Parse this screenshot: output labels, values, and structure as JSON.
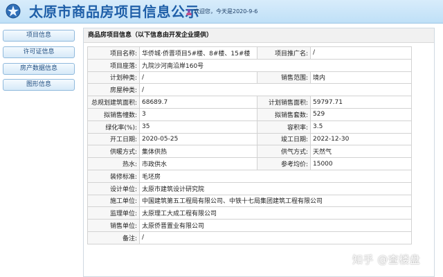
{
  "header": {
    "title": "太原市商品房项目信息公示",
    "welcome": "欢迎您，今天是2020-9-6"
  },
  "sidebar": {
    "items": [
      {
        "label": "项目信息"
      },
      {
        "label": "许可证信息"
      },
      {
        "label": "房产数据信息"
      },
      {
        "label": "图形信息"
      }
    ]
  },
  "panel": {
    "title": "商品房项目信息（以下信息由开发企业提供）",
    "rows": [
      {
        "l1": "项目名称:",
        "v1": "华侨城·侨晋项目5#楼、8#楼、15#楼",
        "l2": "项目推广名:",
        "v2": "/"
      },
      {
        "l1": "项目座落:",
        "v1": "九院沙河南沿岸160号"
      },
      {
        "l1": "计划种类:",
        "v1": "/",
        "l2": "销售范围:",
        "v2": "境内"
      },
      {
        "l1": "房屋种类:",
        "v1": "/"
      },
      {
        "l1": "总规划建筑面积:",
        "v1": "68689.7",
        "l2": "计划销售面积:",
        "v2": "59797.71"
      },
      {
        "l1": "拟销售幢数:",
        "v1": "3",
        "l2": "拟销售套数:",
        "v2": "529"
      },
      {
        "l1": "绿化率(%):",
        "v1": "35",
        "l2": "容积率:",
        "v2": "3.5"
      },
      {
        "l1": "开工日期:",
        "v1": "2020-05-25",
        "l2": "竣工日期:",
        "v2": "2022-12-30"
      },
      {
        "l1": "供暖方式:",
        "v1": "集体供热",
        "l2": "供气方式:",
        "v2": "天然气"
      },
      {
        "l1": "热水:",
        "v1": "市政供水",
        "l2": "参考均价:",
        "v2": "15000"
      },
      {
        "l1": "装修标准:",
        "v1": "毛坯房"
      },
      {
        "l1": "设计单位:",
        "v1": "太原市建筑设计研究院"
      },
      {
        "l1": "施工单位:",
        "v1": "中国建筑第五工程局有限公司、中铁十七局集团建筑工程有限公司"
      },
      {
        "l1": "监理单位:",
        "v1": "太原理工大成工程有限公司"
      },
      {
        "l1": "销售单位:",
        "v1": "太原侨晋置业有限公司"
      },
      {
        "l1": "备注:",
        "v1": "/"
      }
    ]
  },
  "watermark": "知乎 @查楼盘",
  "colors": {
    "header_bg": "#c9e5f9",
    "title_blue": "#1f5fa8",
    "nav_border": "#8fb9dc"
  }
}
